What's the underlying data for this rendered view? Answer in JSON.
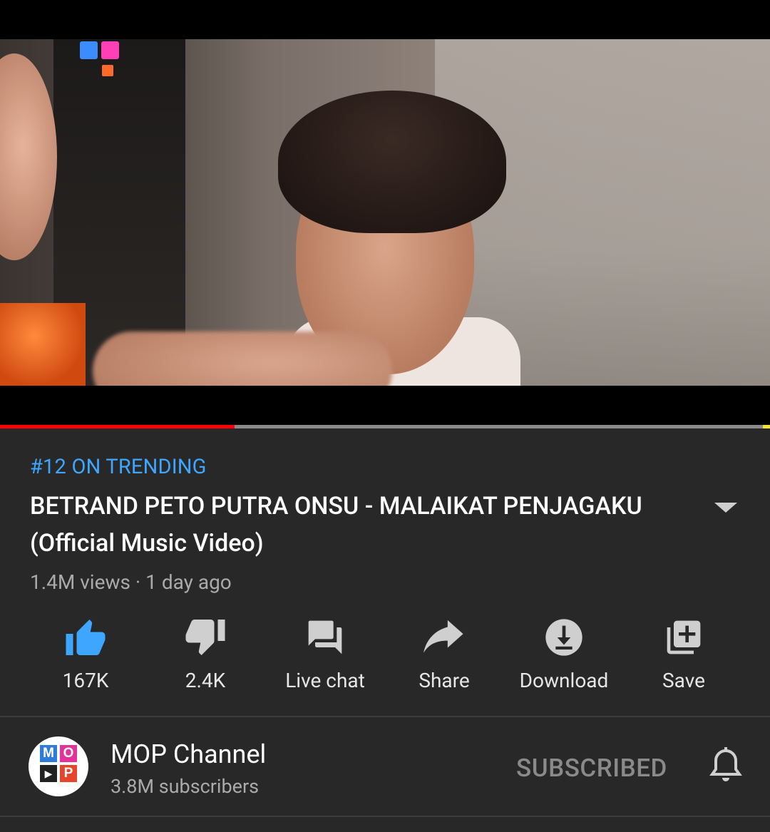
{
  "player": {
    "progress_fraction": 0.305
  },
  "video": {
    "trending": "#12 ON TRENDING",
    "title": "BETRAND PETO PUTRA ONSU - MALAIKAT PENJAGAKU (Official Music Video)",
    "meta": "1.4M views · 1 day ago"
  },
  "actions": {
    "like": {
      "label": "167K",
      "icon": "thumb-up-icon",
      "color": "#3ea6ff"
    },
    "dislike": {
      "label": "2.4K",
      "icon": "thumb-down-icon"
    },
    "live_chat": {
      "label": "Live chat",
      "icon": "chat-icon"
    },
    "share": {
      "label": "Share",
      "icon": "share-icon"
    },
    "download": {
      "label": "Download",
      "icon": "download-icon"
    },
    "save": {
      "label": "Save",
      "icon": "playlist-add-icon"
    }
  },
  "channel": {
    "name": "MOP Channel",
    "subscribers": "3.8M subscribers",
    "avatar_letters": [
      "M",
      "O",
      "▶",
      "P"
    ],
    "subscribe_state": "SUBSCRIBED"
  },
  "colors": {
    "background": "#282828",
    "accent_blue": "#3ea6ff",
    "progress_red": "#ff0000"
  }
}
